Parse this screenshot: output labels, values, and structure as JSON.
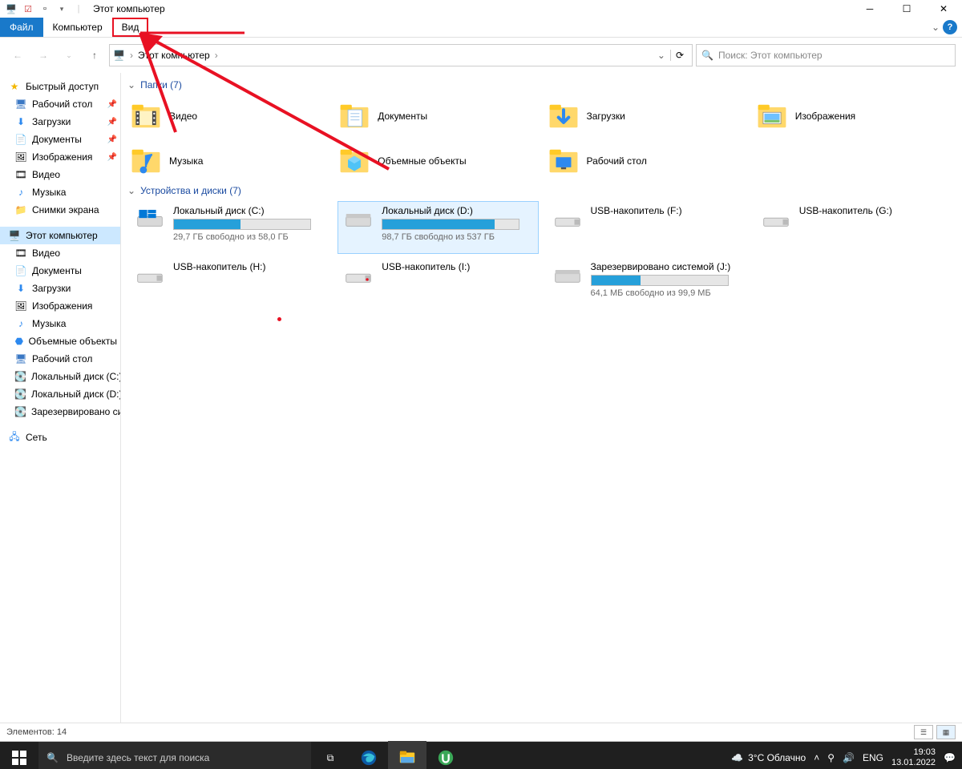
{
  "title": "Этот компьютер",
  "ribbon": {
    "file": "Файл",
    "computer": "Компьютер",
    "view": "Вид"
  },
  "breadcrumb": {
    "root": "Этот компьютер"
  },
  "search_placeholder": "Поиск: Этот компьютер",
  "sidebar": {
    "quick": "Быстрый доступ",
    "desktop": "Рабочий стол",
    "downloads": "Загрузки",
    "documents": "Документы",
    "pictures": "Изображения",
    "videos": "Видео",
    "music": "Музыка",
    "screenshots": "Снимки экрана",
    "thispc": "Этот компьютер",
    "pc_videos": "Видео",
    "pc_documents": "Документы",
    "pc_downloads": "Загрузки",
    "pc_pictures": "Изображения",
    "pc_music": "Музыка",
    "pc_3d": "Объемные объекты",
    "pc_desktop": "Рабочий стол",
    "drive_c": "Локальный диск (C:)",
    "drive_d": "Локальный диск (D:)",
    "drive_j": "Зарезервировано системой",
    "network": "Сеть"
  },
  "groups": {
    "folders": "Папки (7)",
    "drives": "Устройства и диски (7)"
  },
  "folders": {
    "video": "Видео",
    "documents": "Документы",
    "downloads": "Загрузки",
    "pictures": "Изображения",
    "music": "Музыка",
    "objects3d": "Объемные объекты",
    "desktop": "Рабочий стол"
  },
  "drives": {
    "c": {
      "name": "Локальный диск (C:)",
      "sub": "29,7 ГБ свободно из 58,0 ГБ",
      "pct": 49
    },
    "d": {
      "name": "Локальный диск (D:)",
      "sub": "98,7 ГБ свободно из 537 ГБ",
      "pct": 82
    },
    "f": {
      "name": "USB-накопитель (F:)"
    },
    "g": {
      "name": "USB-накопитель (G:)"
    },
    "h": {
      "name": "USB-накопитель (H:)"
    },
    "i": {
      "name": "USB-накопитель (I:)"
    },
    "j": {
      "name": "Зарезервировано системой (J:)",
      "sub": "64,1 МБ свободно из 99,9 МБ",
      "pct": 36
    }
  },
  "status": {
    "items": "Элементов: 14"
  },
  "taskbar": {
    "search": "Введите здесь текст для поиска",
    "weather": "3°C  Облачно",
    "lang": "ENG",
    "time": "19:03",
    "date": "13.01.2022"
  }
}
